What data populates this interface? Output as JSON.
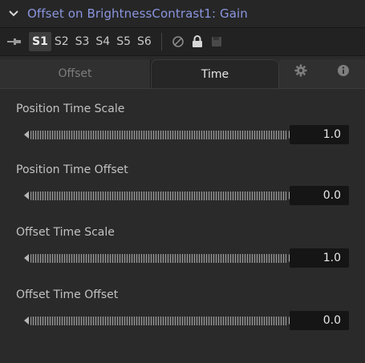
{
  "header": {
    "collapse_icon": "chevron-down-icon",
    "title": "Offset on BrightnessContrast1: Gain",
    "title_color": "#8a96e0"
  },
  "toolbar": {
    "pin_icon": "pin-icon",
    "slots": [
      "S1",
      "S2",
      "S3",
      "S4",
      "S5",
      "S6"
    ],
    "active_slot": "S1",
    "disable_icon": "disable-icon",
    "lock_icon": "lock-icon",
    "save_icon": "save-icon"
  },
  "tabs": {
    "offset": "Offset",
    "time": "Time",
    "active": "Time",
    "settings_icon": "gear-icon",
    "info_icon": "info-icon"
  },
  "params": [
    {
      "label": "Position Time Scale",
      "value": "1.0"
    },
    {
      "label": "Position Time Offset",
      "value": "0.0"
    },
    {
      "label": "Offset Time Scale",
      "value": "1.0"
    },
    {
      "label": "Offset Time Offset",
      "value": "0.0"
    }
  ]
}
